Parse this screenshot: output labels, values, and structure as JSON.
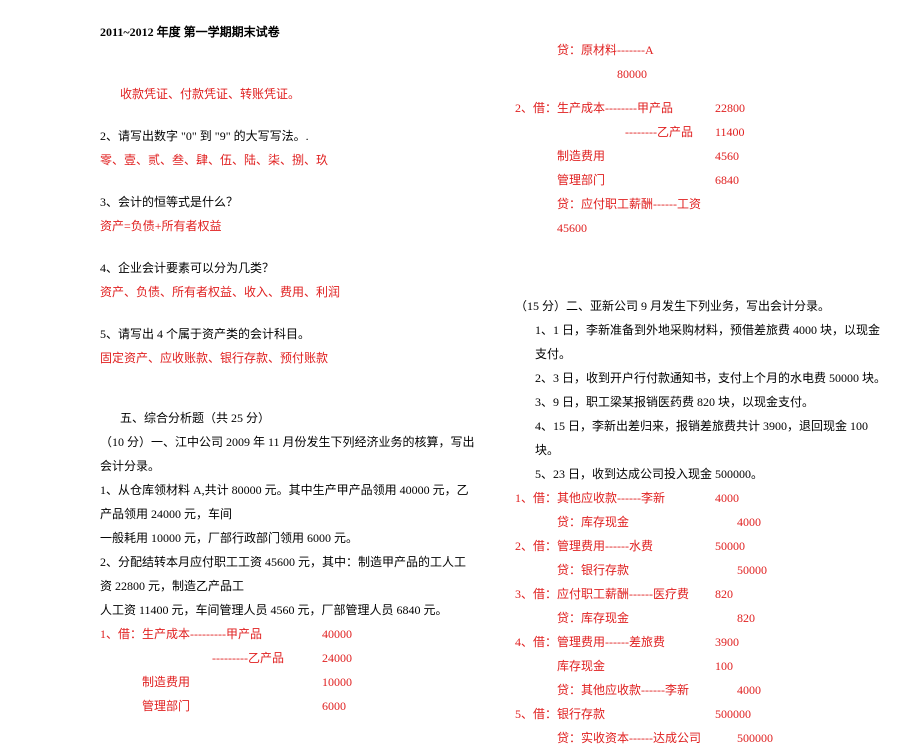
{
  "header": "2011~2012 年度 第一学期期末试卷",
  "left": {
    "l1": "收款凭证、付款凭证、转账凭证。",
    "l2": "2、请写出数字 \"0\" 到 \"9\" 的大写写法。.",
    "l3": "零、壹、贰、叁、肆、伍、陆、柒、捌、玖",
    "l4": "3、会计的恒等式是什么？",
    "l5": "资产=负债+所有者权益",
    "l6": "4、企业会计要素可以分为几类？",
    "l7": "资产、负债、所有者权益、收入、费用、利润",
    "l8": "5、请写出 4 个属于资产类的会计科目。",
    "l9": "固定资产、应收账款、银行存款、预付账款",
    "sec5_title": "五、综合分析题（共 25 分）",
    "p1_intro": "（10 分）一、江中公司 2009 年 11 月份发生下列经济业务的核算，写出会计分录。",
    "p1_1": "1、从仓库领材料 A,共计 80000 元。其中生产甲产品领用 40000 元，乙产品领用 24000 元，车间",
    "p1_1b": "一般耗用 10000 元，厂部行政部门领用 6000 元。",
    "p1_2": "2、分配结转本月应付职工工资 45600 元，其中：制造甲产品的工人工资 22800 元，制造乙产品工",
    "p1_2b": "人工资 11400 元，车间管理人员 4560 元，厂部管理人员 6840 元。",
    "e1": {
      "prefix": "1、借：",
      "a": "生产成本---------甲产品",
      "av": "40000"
    },
    "e1b": {
      "a": "---------乙产品",
      "av": "24000"
    },
    "e1c": {
      "a": "制造费用",
      "av": "10000"
    },
    "e1d": {
      "a": "管理部门",
      "av": "6000"
    }
  },
  "right": {
    "r0": {
      "a": "贷：原材料-------A",
      "av": "80000"
    },
    "r1": {
      "prefix": "2、借：",
      "a": "生产成本--------甲产品",
      "av": "22800"
    },
    "r1b": {
      "a": "--------乙产品",
      "av": "11400"
    },
    "r1c": {
      "a": "制造费用",
      "av": "4560"
    },
    "r1d": {
      "a": "管理部门",
      "av": "6840"
    },
    "r1e": {
      "a": "贷：应付职工薪酬------工资",
      "av": "45600"
    },
    "p2_intro": "（15 分）二、亚新公司 9 月发生下列业务，写出会计分录。",
    "p2_1": "1、1 日，李新准备到外地采购材料，预借差旅费 4000 块，以现金支付。",
    "p2_2": "2、3 日，收到开户行付款通知书，支付上个月的水电费 50000 块。",
    "p2_3": "3、9 日，职工梁某报销医药费 820 块，以现金支付。",
    "p2_4": "4、15 日，李新出差归来，报销差旅费共计 3900，退回现金 100 块。",
    "p2_5": "5、23 日，收到达成公司投入现金 500000。",
    "e1": {
      "prefix": "1、借：",
      "a": "其他应收款------李新",
      "av": "4000"
    },
    "e1b": {
      "a": "贷：库存现金",
      "av": "4000"
    },
    "e2": {
      "prefix": "2、借：",
      "a": "管理费用------水费",
      "av": "50000"
    },
    "e2b": {
      "a": "贷：银行存款",
      "av": "50000"
    },
    "e3": {
      "prefix": "3、借：",
      "a": "应付职工薪酬------医疗费",
      "av": "820"
    },
    "e3b": {
      "a": "贷：库存现金",
      "av": "820"
    },
    "e4": {
      "prefix": "4、借：",
      "a": "管理费用------差旅费",
      "av": "3900"
    },
    "e4b": {
      "a": "库存现金",
      "av": "100"
    },
    "e4c": {
      "a": "贷：其他应收款------李新",
      "av": "4000"
    },
    "e5": {
      "prefix": "5、借：",
      "a": "银行存款",
      "av": "500000"
    },
    "e5b": {
      "a": "贷：实收资本------达成公司",
      "av": "500000"
    }
  }
}
